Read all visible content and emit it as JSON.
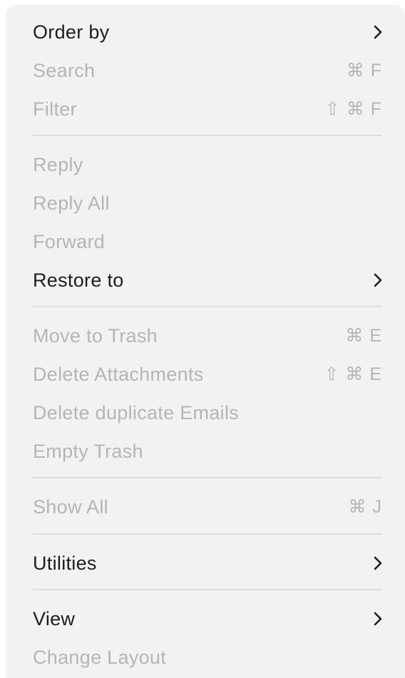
{
  "menu": {
    "items": [
      {
        "label": "Order by",
        "enabled": true,
        "submenu": true,
        "shortcut": ""
      },
      {
        "label": "Search",
        "enabled": false,
        "submenu": false,
        "shortcut": "⌘ F"
      },
      {
        "label": "Filter",
        "enabled": false,
        "submenu": false,
        "shortcut": "⇧ ⌘ F"
      },
      {
        "label": "Reply",
        "enabled": false,
        "submenu": false,
        "shortcut": ""
      },
      {
        "label": "Reply All",
        "enabled": false,
        "submenu": false,
        "shortcut": ""
      },
      {
        "label": "Forward",
        "enabled": false,
        "submenu": false,
        "shortcut": ""
      },
      {
        "label": "Restore to",
        "enabled": true,
        "submenu": true,
        "shortcut": ""
      },
      {
        "label": "Move to Trash",
        "enabled": false,
        "submenu": false,
        "shortcut": "⌘ E"
      },
      {
        "label": "Delete Attachments",
        "enabled": false,
        "submenu": false,
        "shortcut": "⇧ ⌘ E"
      },
      {
        "label": "Delete duplicate Emails",
        "enabled": false,
        "submenu": false,
        "shortcut": ""
      },
      {
        "label": "Empty Trash",
        "enabled": false,
        "submenu": false,
        "shortcut": ""
      },
      {
        "label": "Show All",
        "enabled": false,
        "submenu": false,
        "shortcut": "⌘ J"
      },
      {
        "label": "Utilities",
        "enabled": true,
        "submenu": true,
        "shortcut": ""
      },
      {
        "label": "View",
        "enabled": true,
        "submenu": true,
        "shortcut": ""
      },
      {
        "label": "Change Layout",
        "enabled": false,
        "submenu": false,
        "shortcut": ""
      }
    ]
  },
  "colors": {
    "menu_background": "#f2f2f2",
    "enabled_text": "#1d1d1f",
    "disabled_text": "#b5b5b5",
    "separator": "#dcdcdc"
  }
}
